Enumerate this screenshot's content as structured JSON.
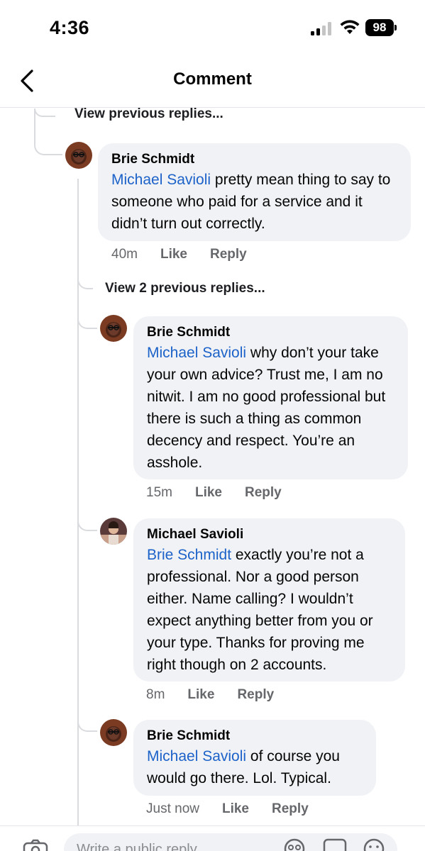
{
  "status_bar": {
    "time": "4:36",
    "battery": "98"
  },
  "header": {
    "title": "Comment"
  },
  "thread": {
    "view_previous_top": "View previous replies...",
    "view_previous_nested": "View 2 previous replies..."
  },
  "comments": [
    {
      "author": "Brie Schmidt",
      "mention": "Michael Savioli",
      "text": " pretty mean thing to say to someone who paid for a service and it didn’t turn out correctly.",
      "time": "40m",
      "like": "Like",
      "reply": "Reply"
    },
    {
      "author": "Brie Schmidt",
      "mention": "Michael Savioli",
      "text": " why don’t your take your own advice? Trust me, I am no nitwit. I am no good professional but there is such a thing as common decency and respect. You’re an asshole.",
      "time": "15m",
      "like": "Like",
      "reply": "Reply"
    },
    {
      "author": "Michael Savioli",
      "mention": "Brie Schmidt",
      "text": " exactly you’re not a professional. Nor a good person either. Name calling? I wouldn’t expect anything better from you or your type. Thanks for proving me right though on 2 accounts.",
      "time": "8m",
      "like": "Like",
      "reply": "Reply"
    },
    {
      "author": "Brie Schmidt",
      "mention": "Michael Savioli",
      "text": " of course you would go there. Lol. Typical.",
      "time": "Just now",
      "like": "Like",
      "reply": "Reply"
    }
  ],
  "composer": {
    "placeholder": "Write a public reply...",
    "icons": [
      "camera-icon",
      "avatar-sticker-icon",
      "gif-icon",
      "emoji-icon"
    ]
  },
  "colors": {
    "mention": "#1c62c9",
    "bubble": "#f0f2f5",
    "meta": "#65676b"
  }
}
